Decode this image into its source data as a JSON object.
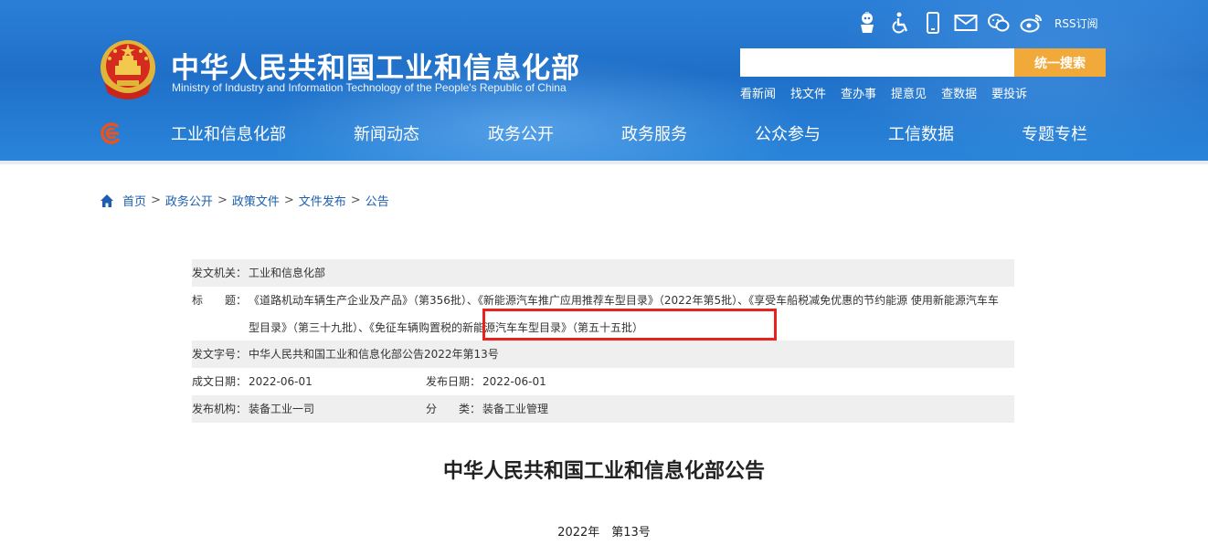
{
  "header": {
    "title": "中华人民共和国工业和信息化部",
    "subtitle": "Ministry of Industry and Information Technology of the People's Republic of China",
    "tool_icons": [
      "robot-icon",
      "accessibility-icon",
      "mobile-icon",
      "mail-icon",
      "wechat-icon",
      "weibo-icon"
    ],
    "rss_label": "RSS订阅",
    "search": {
      "placeholder": "",
      "button_label": "统一搜索"
    },
    "quick_links": [
      "看新闻",
      "找文件",
      "查办事",
      "提意见",
      "查数据",
      "要投诉"
    ],
    "nav": [
      "工业和信息化部",
      "新闻动态",
      "政务公开",
      "政务服务",
      "公众参与",
      "工信数据",
      "专题专栏"
    ],
    "colors": {
      "header_blue": "#1f6fc8",
      "search_button": "#f1a93a",
      "highlight": "#e8231e",
      "link": "#1d5fae"
    }
  },
  "breadcrumb": [
    "首页",
    "政务公开",
    "政策文件",
    "文件发布",
    "公告"
  ],
  "breadcrumb_sep": ">",
  "info": {
    "issuer_label": "发文机关：",
    "issuer": "工业和信息化部",
    "title_label": "标　　题：",
    "title_value": "《道路机动车辆生产企业及产品》（第356批）、《新能源汽车推广应用推荐车型目录》（2022年第5批）、《享受车船税减免优惠的节约能源 使用新能源汽车车型目录》（第三十九批）、《免征车辆购置税的新能源汽车车型目录》（第五十五批）",
    "doc_no_label": "发文字号：",
    "doc_no": "中华人民共和国工业和信息化部公告2022年第13号",
    "date_label": "成文日期：",
    "date": "2022-06-01",
    "pub_date_label": "发布日期：",
    "pub_date": "2022-06-01",
    "org_label": "发布机构：",
    "org": "装备工业一司",
    "category_label": "分　　类：",
    "category": "装备工业管理"
  },
  "document": {
    "title": "中华人民共和国工业和信息化部公告",
    "number": "2022年　第13号"
  }
}
